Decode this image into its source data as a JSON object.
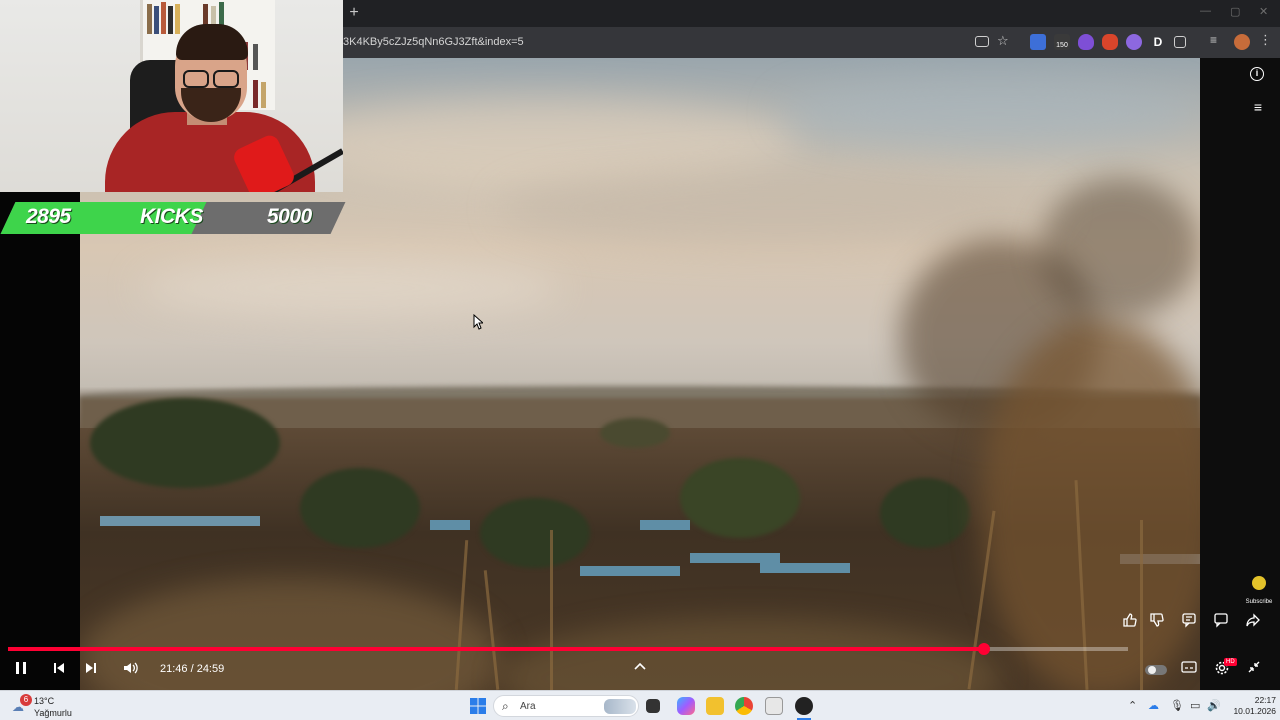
{
  "browser": {
    "new_tab_symbol": "+",
    "url": "3K4KBy5cZJz5qNn6GJ3Zft&index=5",
    "window_controls": [
      "—",
      "▢",
      "✕"
    ],
    "toolbar_icons": [
      "install-icon",
      "bookmark-star-icon",
      "translate-icon",
      "extension-150-icon",
      "shield-extension-icon",
      "fox-extension-icon",
      "ai-extension-icon",
      "d-extension-icon",
      "puzzle-icon",
      "media-icon",
      "profile-avatar"
    ],
    "extension_badge": "150",
    "d_extension_label": "D"
  },
  "stream_overlay": {
    "kicks": {
      "current": "2895",
      "label": "KICKS",
      "goal": "5000",
      "progress": 0.579,
      "fill_color": "#3ed44b",
      "bg_color": "#6d6d6d"
    }
  },
  "player": {
    "current_time": "21:46",
    "duration": "24:59",
    "time_display": "21:46 / 24:59",
    "progress": 0.871,
    "progress_color": "#ff0033",
    "right_panel_icons": [
      "info-icon",
      "queue-icon"
    ],
    "action_buttons": [
      "like-icon",
      "dislike-icon",
      "comment-icon",
      "chat-icon",
      "share-icon"
    ],
    "subscribe_label": "Subscribe",
    "quality_badge": "HD"
  },
  "taskbar": {
    "weather_badge": "6",
    "weather_temp": "13°C",
    "weather_condition": "Yağmurlu",
    "search_placeholder": "Ara",
    "time": "22:17",
    "date": "10.01.2026"
  }
}
